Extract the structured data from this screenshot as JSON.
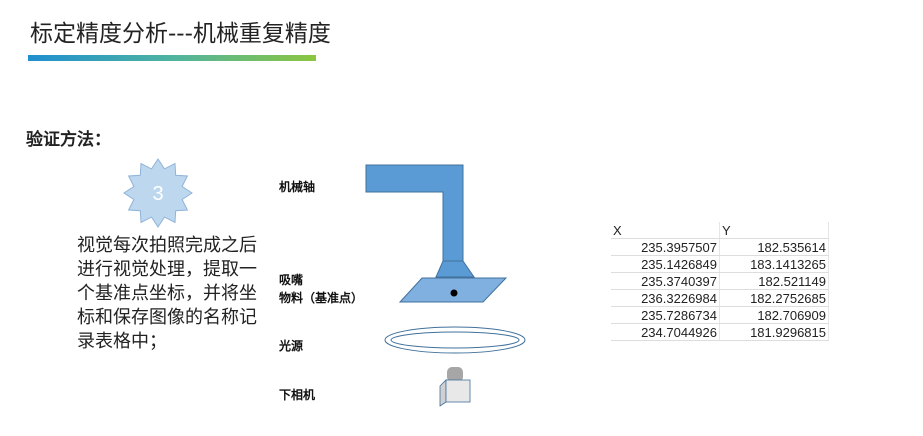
{
  "title": "标定精度分析---机械重复精度",
  "method_label": "验证方法：",
  "step": {
    "number": "3",
    "description": "视觉每次拍照完成之后进行视觉处理，提取一个基准点坐标，并将坐标和保存图像的名称记录表格中；"
  },
  "diagram": {
    "labels": {
      "axis": "机械轴",
      "nozzle": "吸嘴",
      "material": "物料（基准点）",
      "light": "光源",
      "camera": "下相机"
    }
  },
  "table": {
    "headers": [
      "X",
      "Y"
    ],
    "rows": [
      [
        "235.3957507",
        "182.535614"
      ],
      [
        "235.1426849",
        "183.1413265"
      ],
      [
        "235.3740397",
        "182.521149"
      ],
      [
        "236.3226984",
        "182.2752685"
      ],
      [
        "235.7286734",
        "182.706909"
      ],
      [
        "234.7044926",
        "181.9296815"
      ]
    ]
  }
}
